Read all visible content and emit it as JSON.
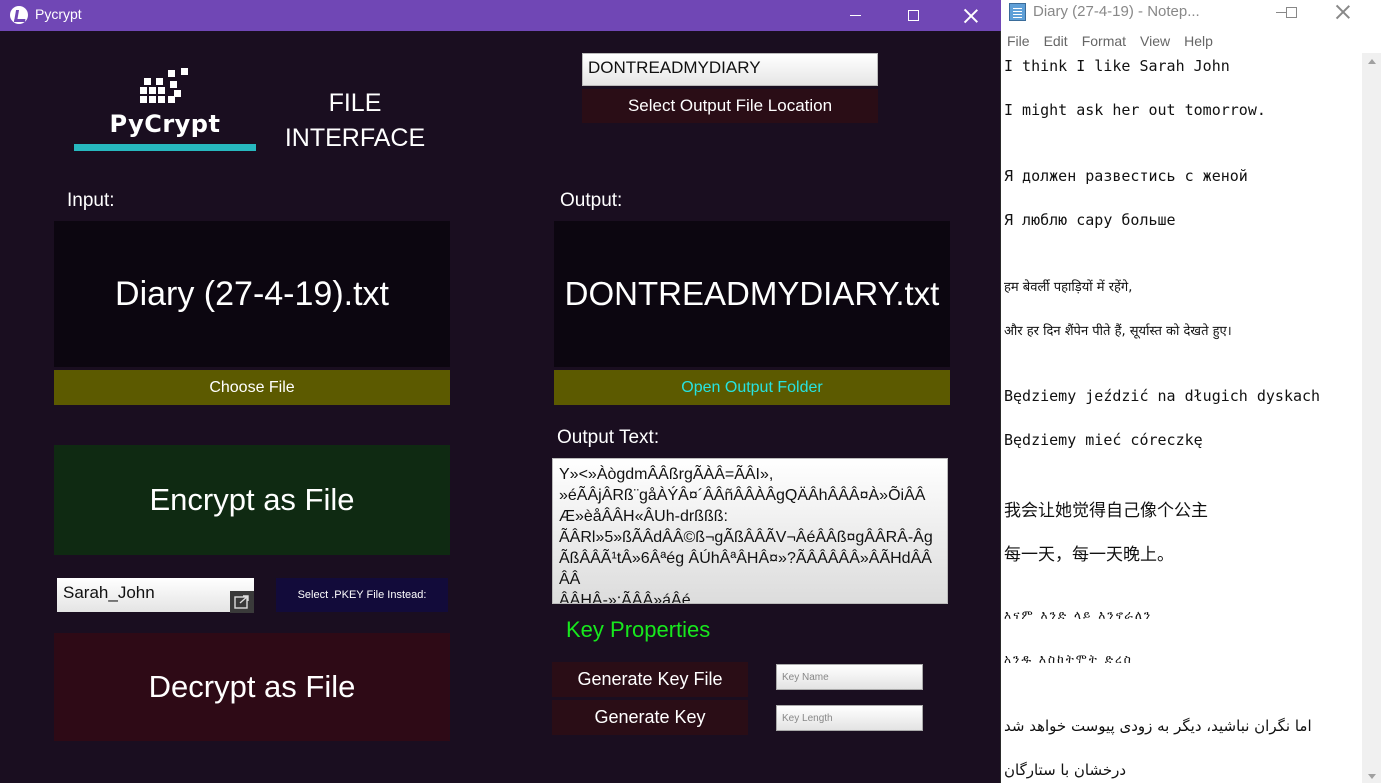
{
  "pycrypt": {
    "window_title": "Pycrypt",
    "logo_text": "PyCrypt",
    "heading_line1": "FILE",
    "heading_line2": "INTERFACE",
    "output_name_value": "DONTREADMYDIARY",
    "select_output_label": "Select Output File Location",
    "input_label": "Input:",
    "output_label": "Output:",
    "input_file": "Diary (27-4-19).txt",
    "output_file": "DONTREADMYDIARY.txt",
    "choose_file_label": "Choose File",
    "open_output_label": "Open Output Folder",
    "output_text_label": "Output Text:",
    "output_text": "Y»<»ÀògdmÂÂßrgÃÀÂ=ÃÂI»,\n»éÃÂjÂRß¨gåÀÝÂ¤´ÂÂñÂÂÀÂgQÄÂhÂÂÂ¤À»ÕiÂÂ\nÆ»èåÂÂH«ÂUh-drßßß:\nÃÂRl»5»ßÃÂdÂÂ©ß¬gÃßÂÂÃV¬ÂéÂÂß¤gÂÂRÂ-Âg\nÃßÂÂÃ¹tÂ»6Âªég ÂÚhÂªÂHÂ¤»?ÃÂÂÂÂÂ»ÂÃHdÂÂÂÂ\nÂÂHÂ-»:ÃÂÂ»áÂé",
    "encrypt_label": "Encrypt as File",
    "key_value": "Sarah_John",
    "pkey_label": "Select .PKEY File Instead:",
    "decrypt_label": "Decrypt as File",
    "key_props_label": "Key Properties",
    "gen_key_file_label": "Generate Key File",
    "gen_key_label": "Generate Key",
    "key_name_placeholder": "Key Name",
    "key_length_placeholder": "Key Length",
    "colors": {
      "titlebar": "#7047b5",
      "background": "#1a0e20",
      "olive": "#5c5a00",
      "encrypt": "#0f2a12",
      "decrypt": "#2e0a16",
      "key_props": "#17e81d",
      "open_output_text": "#27e3e0"
    }
  },
  "notepad": {
    "window_title": "Diary (27-4-19) - Notep...",
    "menu": [
      "File",
      "Edit",
      "Format",
      "View",
      "Help"
    ],
    "lines": [
      "I think I like Sarah John",
      "I might ask her out tomorrow.",
      "Я должен развестись с женой",
      "Я люблю сару больше",
      "हम बेवर्ली पहाड़ियों में रहेंगे,",
      "और हर दिन शैंपेन पीते हैं, सूर्यास्त को देखते हुए।",
      "Będziemy jeździć na długich dyskach",
      "Będziemy mieć córeczkę",
      "我会让她觉得自己像个公主",
      "每一天，每一天晚上。",
      "እናም እንድ ላይ እንኖራለን",
      "አንዱ እስከትሞት ድረስ",
      "اما نگران نباشید، دیگر به زودی پیوست خواهد شد",
      "درخشان با ستارگان"
    ]
  }
}
